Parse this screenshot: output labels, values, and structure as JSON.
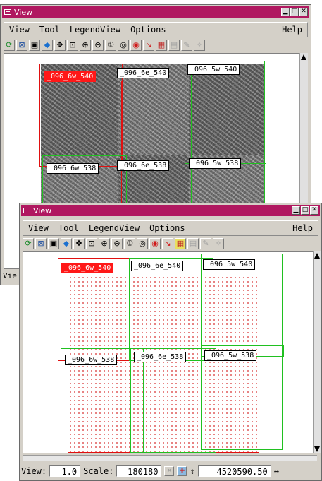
{
  "window_title": "View",
  "menus": [
    "View",
    "Tool",
    "LegendView",
    "Options"
  ],
  "help_label": "Help",
  "tile_labels": {
    "t1": "_096_6w_540",
    "t2": "_096_6e_540",
    "t3": "_096_5w_540",
    "t4": "_096_6w_538",
    "t5": "_096_6e_538",
    "t6": "_096_5w_538"
  },
  "back_partial_status": "Vie",
  "status": {
    "view_label": "View:",
    "view_value": "1.0",
    "scale_label": "Scale:",
    "scale_value": "180180",
    "coord_value": "4520590.50"
  },
  "toolbar_icons": [
    "redraw-icon",
    "full-extent-icon",
    "window-icon",
    "select-icon",
    "pan-icon",
    "zoom-box-icon",
    "zoom-in-icon",
    "zoom-out-icon",
    "zoom-1x-icon",
    "zoom-previous-icon",
    "locate-icon",
    "arrow-tool-icon",
    "layer-icon",
    "grid-icon",
    "pencil-icon",
    "measure-icon"
  ],
  "colors": {
    "titlebar": "#b01860",
    "selected_tag": "#ff1818",
    "red_frame": "#e01010",
    "green_frame": "#20c020"
  }
}
